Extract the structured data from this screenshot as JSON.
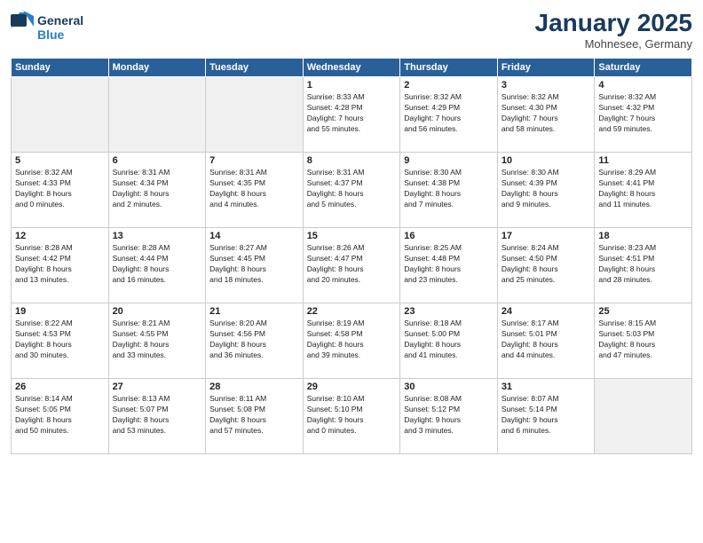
{
  "header": {
    "logo_line1": "General",
    "logo_line2": "Blue",
    "month": "January 2025",
    "location": "Mohnesee, Germany"
  },
  "weekdays": [
    "Sunday",
    "Monday",
    "Tuesday",
    "Wednesday",
    "Thursday",
    "Friday",
    "Saturday"
  ],
  "weeks": [
    [
      {
        "day": "",
        "text": ""
      },
      {
        "day": "",
        "text": ""
      },
      {
        "day": "",
        "text": ""
      },
      {
        "day": "1",
        "text": "Sunrise: 8:33 AM\nSunset: 4:28 PM\nDaylight: 7 hours\nand 55 minutes."
      },
      {
        "day": "2",
        "text": "Sunrise: 8:32 AM\nSunset: 4:29 PM\nDaylight: 7 hours\nand 56 minutes."
      },
      {
        "day": "3",
        "text": "Sunrise: 8:32 AM\nSunset: 4:30 PM\nDaylight: 7 hours\nand 58 minutes."
      },
      {
        "day": "4",
        "text": "Sunrise: 8:32 AM\nSunset: 4:32 PM\nDaylight: 7 hours\nand 59 minutes."
      }
    ],
    [
      {
        "day": "5",
        "text": "Sunrise: 8:32 AM\nSunset: 4:33 PM\nDaylight: 8 hours\nand 0 minutes."
      },
      {
        "day": "6",
        "text": "Sunrise: 8:31 AM\nSunset: 4:34 PM\nDaylight: 8 hours\nand 2 minutes."
      },
      {
        "day": "7",
        "text": "Sunrise: 8:31 AM\nSunset: 4:35 PM\nDaylight: 8 hours\nand 4 minutes."
      },
      {
        "day": "8",
        "text": "Sunrise: 8:31 AM\nSunset: 4:37 PM\nDaylight: 8 hours\nand 5 minutes."
      },
      {
        "day": "9",
        "text": "Sunrise: 8:30 AM\nSunset: 4:38 PM\nDaylight: 8 hours\nand 7 minutes."
      },
      {
        "day": "10",
        "text": "Sunrise: 8:30 AM\nSunset: 4:39 PM\nDaylight: 8 hours\nand 9 minutes."
      },
      {
        "day": "11",
        "text": "Sunrise: 8:29 AM\nSunset: 4:41 PM\nDaylight: 8 hours\nand 11 minutes."
      }
    ],
    [
      {
        "day": "12",
        "text": "Sunrise: 8:28 AM\nSunset: 4:42 PM\nDaylight: 8 hours\nand 13 minutes."
      },
      {
        "day": "13",
        "text": "Sunrise: 8:28 AM\nSunset: 4:44 PM\nDaylight: 8 hours\nand 16 minutes."
      },
      {
        "day": "14",
        "text": "Sunrise: 8:27 AM\nSunset: 4:45 PM\nDaylight: 8 hours\nand 18 minutes."
      },
      {
        "day": "15",
        "text": "Sunrise: 8:26 AM\nSunset: 4:47 PM\nDaylight: 8 hours\nand 20 minutes."
      },
      {
        "day": "16",
        "text": "Sunrise: 8:25 AM\nSunset: 4:48 PM\nDaylight: 8 hours\nand 23 minutes."
      },
      {
        "day": "17",
        "text": "Sunrise: 8:24 AM\nSunset: 4:50 PM\nDaylight: 8 hours\nand 25 minutes."
      },
      {
        "day": "18",
        "text": "Sunrise: 8:23 AM\nSunset: 4:51 PM\nDaylight: 8 hours\nand 28 minutes."
      }
    ],
    [
      {
        "day": "19",
        "text": "Sunrise: 8:22 AM\nSunset: 4:53 PM\nDaylight: 8 hours\nand 30 minutes."
      },
      {
        "day": "20",
        "text": "Sunrise: 8:21 AM\nSunset: 4:55 PM\nDaylight: 8 hours\nand 33 minutes."
      },
      {
        "day": "21",
        "text": "Sunrise: 8:20 AM\nSunset: 4:56 PM\nDaylight: 8 hours\nand 36 minutes."
      },
      {
        "day": "22",
        "text": "Sunrise: 8:19 AM\nSunset: 4:58 PM\nDaylight: 8 hours\nand 39 minutes."
      },
      {
        "day": "23",
        "text": "Sunrise: 8:18 AM\nSunset: 5:00 PM\nDaylight: 8 hours\nand 41 minutes."
      },
      {
        "day": "24",
        "text": "Sunrise: 8:17 AM\nSunset: 5:01 PM\nDaylight: 8 hours\nand 44 minutes."
      },
      {
        "day": "25",
        "text": "Sunrise: 8:15 AM\nSunset: 5:03 PM\nDaylight: 8 hours\nand 47 minutes."
      }
    ],
    [
      {
        "day": "26",
        "text": "Sunrise: 8:14 AM\nSunset: 5:05 PM\nDaylight: 8 hours\nand 50 minutes."
      },
      {
        "day": "27",
        "text": "Sunrise: 8:13 AM\nSunset: 5:07 PM\nDaylight: 8 hours\nand 53 minutes."
      },
      {
        "day": "28",
        "text": "Sunrise: 8:11 AM\nSunset: 5:08 PM\nDaylight: 8 hours\nand 57 minutes."
      },
      {
        "day": "29",
        "text": "Sunrise: 8:10 AM\nSunset: 5:10 PM\nDaylight: 9 hours\nand 0 minutes."
      },
      {
        "day": "30",
        "text": "Sunrise: 8:08 AM\nSunset: 5:12 PM\nDaylight: 9 hours\nand 3 minutes."
      },
      {
        "day": "31",
        "text": "Sunrise: 8:07 AM\nSunset: 5:14 PM\nDaylight: 9 hours\nand 6 minutes."
      },
      {
        "day": "",
        "text": ""
      }
    ]
  ]
}
